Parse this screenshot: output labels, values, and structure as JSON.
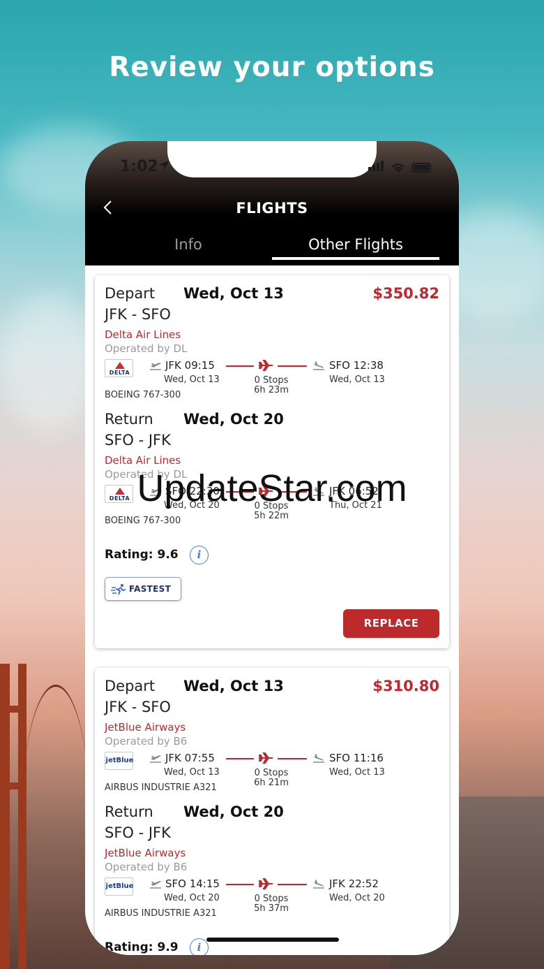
{
  "headline": "Review your options",
  "status_bar": {
    "time": "1:02"
  },
  "header": {
    "title": "FLIGHTS"
  },
  "tabs": [
    {
      "label": "Info",
      "active": false
    },
    {
      "label": "Other Flights",
      "active": true
    }
  ],
  "colors": {
    "accent": "#c0282d",
    "button": "#bc2a2c",
    "info": "#4a7fd0"
  },
  "cards": [
    {
      "price": "$350.82",
      "depart": {
        "label": "Depart",
        "date": "Wed, Oct 13",
        "route": "JFK - SFO",
        "airline": "Delta Air Lines",
        "operated": "Operated by DL",
        "logo": "DELTA",
        "dep_time": "JFK 09:15",
        "dep_date": "Wed, Oct 13",
        "stops": "0 Stops",
        "duration": "6h 23m",
        "arr_time": "SFO 12:38",
        "arr_date": "Wed, Oct 13",
        "aircraft": "BOEING 767-300"
      },
      "return": {
        "label": "Return",
        "date": "Wed, Oct 20",
        "route": "SFO - JFK",
        "airline": "Delta Air Lines",
        "operated": "Operated by DL",
        "logo": "DELTA",
        "dep_time": "SFO 22:30",
        "dep_date": "Wed, Oct 20",
        "stops": "0 Stops",
        "duration": "5h 22m",
        "arr_time": "JFK 06:52",
        "arr_date": "Thu, Oct 21",
        "aircraft": "BOEING 767-300"
      },
      "rating": "Rating: 9.6",
      "badge": "FASTEST",
      "button": "REPLACE"
    },
    {
      "price": "$310.80",
      "depart": {
        "label": "Depart",
        "date": "Wed, Oct 13",
        "route": "JFK - SFO",
        "airline": "JetBlue Airways",
        "operated": "Operated by B6",
        "logo": "jetBlue",
        "dep_time": "JFK 07:55",
        "dep_date": "Wed, Oct 13",
        "stops": "0 Stops",
        "duration": "6h 21m",
        "arr_time": "SFO 11:16",
        "arr_date": "Wed, Oct 13",
        "aircraft": "AIRBUS INDUSTRIE A321"
      },
      "return": {
        "label": "Return",
        "date": "Wed, Oct 20",
        "route": "SFO - JFK",
        "airline": "JetBlue Airways",
        "operated": "Operated by B6",
        "logo": "jetBlue",
        "dep_time": "SFO 14:15",
        "dep_date": "Wed, Oct 20",
        "stops": "0 Stops",
        "duration": "5h 37m",
        "arr_time": "JFK 22:52",
        "arr_date": "Wed, Oct 20",
        "aircraft": "AIRBUS INDUSTRIE A321"
      },
      "rating": "Rating: 9.9"
    }
  ],
  "watermark": "UpdateStar.com"
}
